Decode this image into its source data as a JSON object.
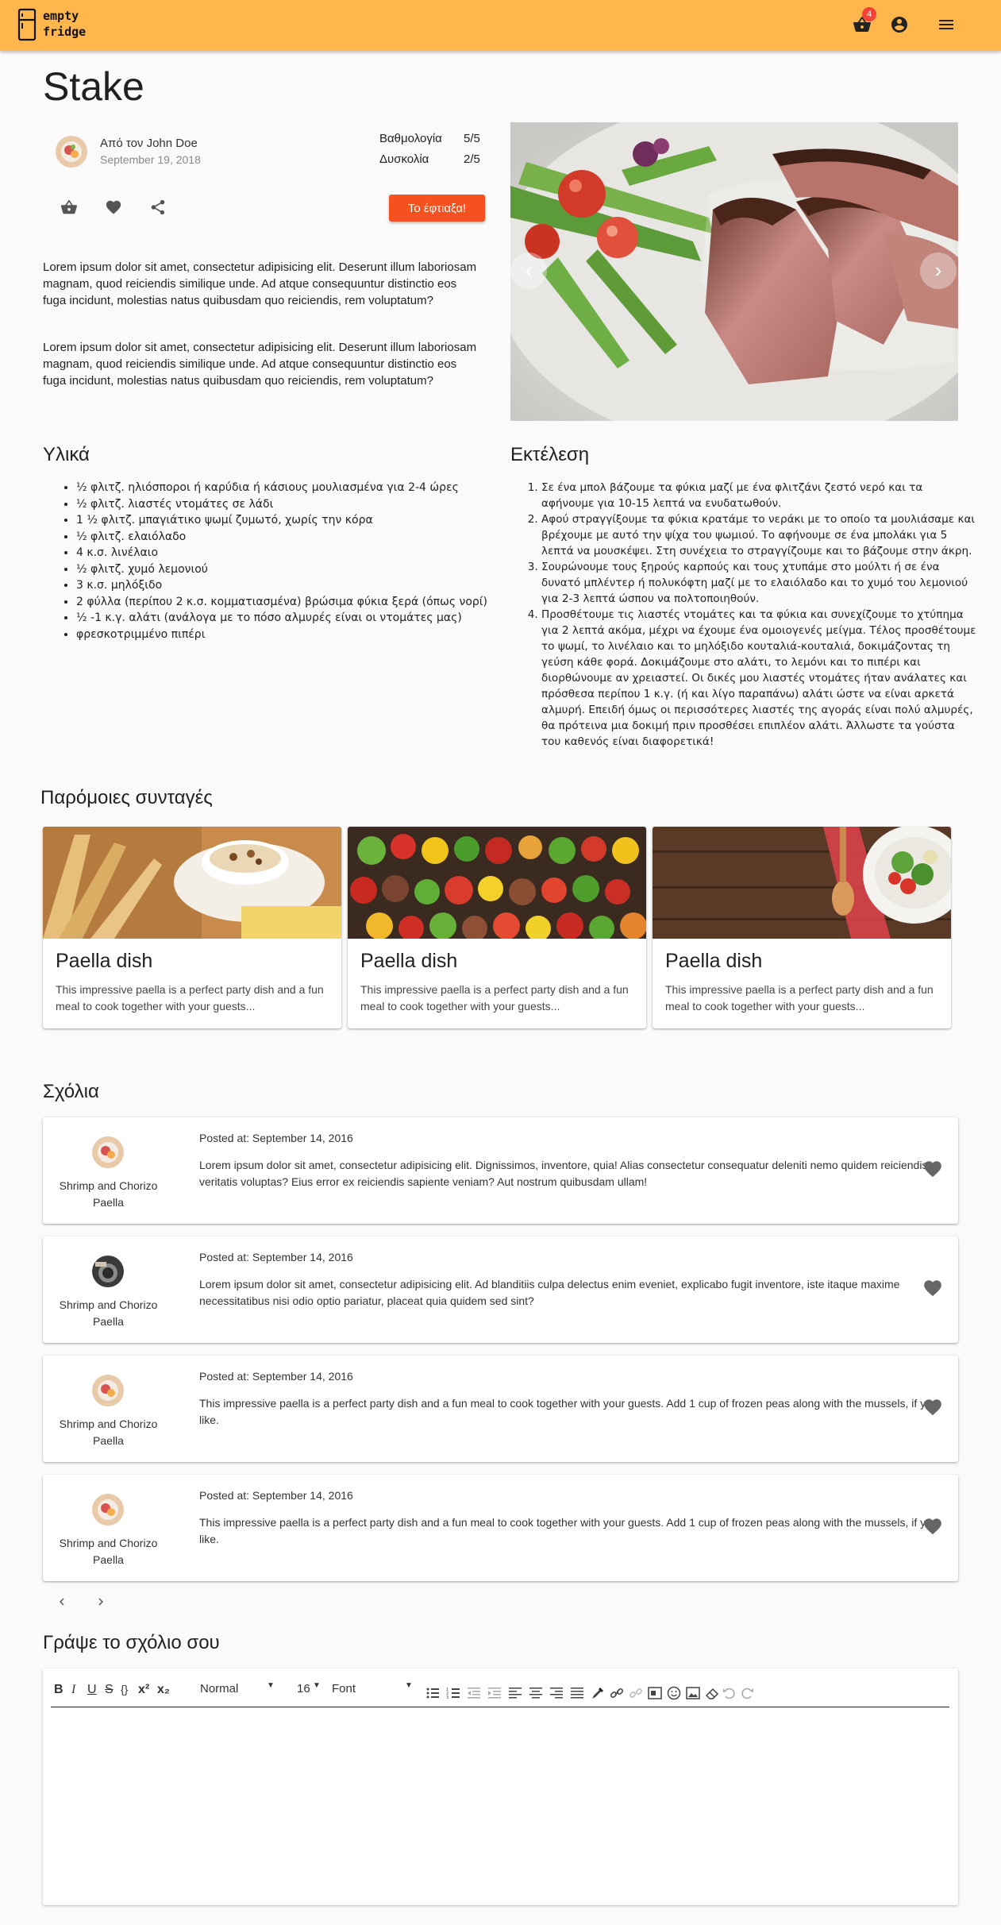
{
  "header": {
    "logo_line1": "empty",
    "logo_line2": "fridge",
    "cart_count": "4"
  },
  "recipe": {
    "title": "Stake",
    "author": "Από τον John Doe",
    "date": "September 19, 2018",
    "rating_label": "Βαθμολογία",
    "rating_value": "5/5",
    "difficulty_label": "Δυσκολία",
    "difficulty_value": "2/5",
    "made_it_label": "Το έφτιαξα!",
    "description_1": "Lorem ipsum dolor sit amet, consectetur adipisicing elit. Deserunt illum laboriosam magnam, quod reiciendis similique unde. Ad atque consequuntur distinctio eos fuga incidunt, molestias natus quibusdam quo reiciendis, rem voluptatum?",
    "description_2": "Lorem ipsum dolor sit amet, consectetur adipisicing elit. Deserunt illum laboriosam magnam, quod reiciendis similique unde. Ad atque consequuntur distinctio eos fuga incidunt, molestias natus quibusdam quo reiciendis, rem voluptatum?"
  },
  "ingredients": {
    "heading": "Υλικά",
    "items": [
      "½ φλιτζ. ηλιόσποροι ή καρύδια ή κάσιους μουλιασμένα για 2-4 ώρες",
      "½ φλιτζ. λιαστές ντομάτες σε λάδι",
      "1 ½ φλιτζ. μπαγιάτικο ψωμί ζυμωτό, χωρίς την κόρα",
      "½ φλιτζ. ελαιόλαδο",
      "4 κ.σ. λινέλαιο",
      "½ φλιτζ. χυμό λεμονιού",
      "3 κ.σ. μηλόξιδο",
      "2 φύλλα (περίπου 2 κ.σ. κομματιασμένα) βρώσιμα φύκια ξερά (όπως νορί)",
      "½ -1 κ.γ. αλάτι (ανάλογα με το πόσο αλμυρές είναι οι ντομάτες μας)",
      "φρεσκοτριμμένο πιπέρι"
    ]
  },
  "steps": {
    "heading": "Εκτέλεση",
    "items": [
      "Σε ένα μπολ βάζουμε τα φύκια μαζί με ένα φλιτζάνι ζεστό νερό και τα αφήνουμε για 10-15 λεπτά να ενυδατωθούν.",
      "Αφού στραγγίξουμε τα φύκια κρατάμε το νεράκι με το οποίο τα μουλιάσαμε και βρέχουμε με αυτό την ψίχα του ψωμιού. Το αφήνουμε σε ένα μπολάκι για 5 λεπτά να μουσκέψει. Στη συνέχεια το στραγγίζουμε και το βάζουμε στην άκρη.",
      "Σουρώνουμε τους ξηρούς καρπούς και τους χτυπάμε στο μούλτι ή σε ένα δυνατό μπλέντερ ή πολυκόφτη μαζί με το ελαιόλαδο και το χυμό του λεμονιού για 2-3 λεπτά ώσπου να πολτοποιηθούν.",
      "Προσθέτουμε τις λιαστές ντομάτες και τα φύκια και συνεχίζουμε το χτύπημα για 2 λεπτά ακόμα, μέχρι να έχουμε ένα ομοιογενές μείγμα. Τέλος προσθέτουμε το ψωμί, το λινέλαιο και το μηλόξιδο κουταλιά-κουταλιά, δοκιμάζοντας τη γεύση κάθε φορά. Δοκιμάζουμε στο αλάτι, το λεμόνι και το πιπέρι και διορθώνουμε αν χρειαστεί. Οι δικές μου λιαστές ντομάτες ήταν ανάλατες και πρόσθεσα περίπου 1 κ.γ. (ή και λίγο παραπάνω) αλάτι ώστε να είναι αρκετά αλμυρή. Επειδή όμως οι περισσότερες λιαστές της αγοράς είναι πολύ αλμυρές, θα πρότεινα μια δοκιμή πριν προσθέσει επιπλέον αλάτι. Άλλωστε τα γούστα του καθενός είναι διαφορετικά!"
    ]
  },
  "similar": {
    "heading": "Παρόμοιες συνταγές",
    "cards": [
      {
        "title": "Paella dish",
        "text": "This impressive paella is a perfect party dish and a fun meal to cook together with your guests..."
      },
      {
        "title": "Paella dish",
        "text": "This impressive paella is a perfect party dish and a fun meal to cook together with your guests..."
      },
      {
        "title": "Paella dish",
        "text": "This impressive paella is a perfect party dish and a fun meal to cook together with your guests..."
      }
    ]
  },
  "comments": {
    "heading": "Σχόλια",
    "items": [
      {
        "name": "Shrimp and Chorizo Paella",
        "date": "Posted at: September 14, 2016",
        "text": "Lorem ipsum dolor sit amet, consectetur adipisicing elit. Dignissimos, inventore, quia! Alias consectetur consequatur deleniti nemo quidem reiciendis veritatis voluptas? Eius error ex reiciendis sapiente veniam? Aut nostrum quibusdam ullam!"
      },
      {
        "name": "Shrimp and Chorizo Paella",
        "date": "Posted at: September 14, 2016",
        "text": "Lorem ipsum dolor sit amet, consectetur adipisicing elit. Ad blanditiis culpa delectus enim eveniet, explicabo fugit inventore, iste itaque maxime necessitatibus nisi odio optio pariatur, placeat quia quidem sed sint?"
      },
      {
        "name": "Shrimp and Chorizo Paella",
        "date": "Posted at: September 14, 2016",
        "text": "This impressive paella is a perfect party dish and a fun meal to cook together with your guests. Add 1 cup of frozen peas along with the mussels, if you like."
      },
      {
        "name": "Shrimp and Chorizo Paella",
        "date": "Posted at: September 14, 2016",
        "text": "This impressive paella is a perfect party dish and a fun meal to cook together with your guests. Add 1 cup of frozen peas along with the mussels, if you like."
      }
    ]
  },
  "editor": {
    "heading": "Γράψε το σχόλιο σου",
    "bold": "B",
    "italic": "I",
    "underline": "U",
    "strike": "S",
    "code": "{}",
    "superscript": "x²",
    "subscript": "x₂",
    "style_value": "Normal",
    "size_value": "16",
    "font_value": "Font"
  },
  "colors": {
    "appbar": "#ffb74d",
    "accent_button": "#f4511e",
    "badge": "#f44336"
  }
}
